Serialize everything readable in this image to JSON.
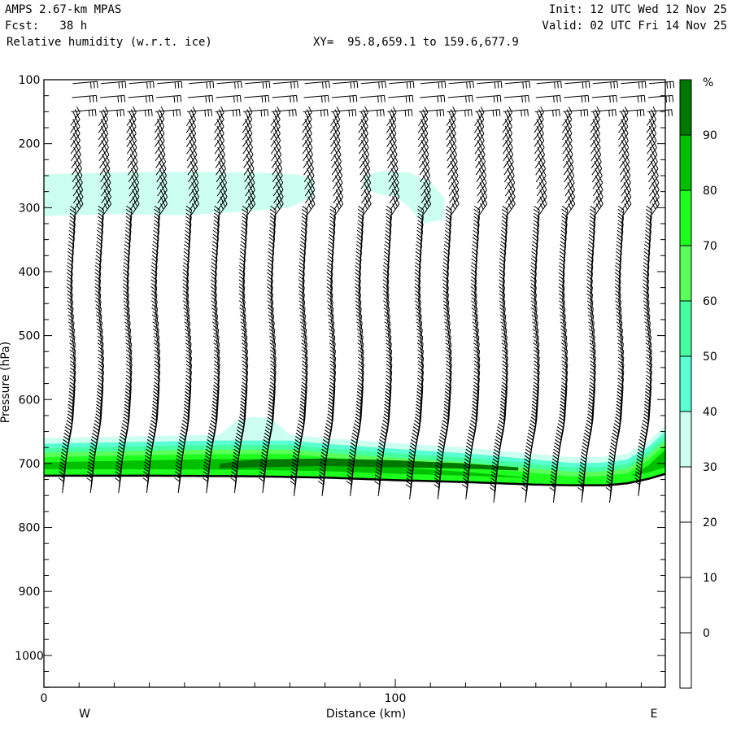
{
  "header": {
    "model": "AMPS 2.67-km MPAS",
    "fcst": "Fcst:   38 h",
    "field": "Relative humidity (w.r.t. ice)",
    "xy": "XY=  95.8,659.1 to 159.6,677.9",
    "init": "Init: 12 UTC Wed 12 Nov 25",
    "valid": "Valid: 02 UTC Fri 14 Nov 25"
  },
  "chart_data": {
    "type": "heatmap",
    "title": "Relative humidity (w.r.t. ice)",
    "xlabel": "Distance (km)",
    "ylabel": "Pressure (hPa)",
    "xlim": [
      0,
      177
    ],
    "ylim": [
      1050,
      100
    ],
    "xticks": [
      0,
      100
    ],
    "xtick_labels": [
      "0",
      "100"
    ],
    "x_minor_step": 10,
    "yticks": [
      100,
      200,
      300,
      400,
      500,
      600,
      700,
      800,
      900,
      1000
    ],
    "ytick_labels": [
      "100",
      "200",
      "300",
      "400",
      "500",
      "600",
      "700",
      "800",
      "900",
      "1000"
    ],
    "left_label": "W",
    "right_label": "E",
    "colorbar": {
      "unit": "%",
      "levels": [
        0,
        10,
        20,
        30,
        40,
        50,
        60,
        70,
        80,
        90
      ],
      "level_labels": [
        "0",
        "10",
        "20",
        "30",
        "40",
        "50",
        "60",
        "70",
        "80",
        "90"
      ],
      "colors": [
        "#ffffff",
        "#ffffff",
        "#ffffff",
        "#ffffff",
        "#cdfff0",
        "#5affd2",
        "#46ffa0",
        "#5aff5a",
        "#1eff1e",
        "#00c000",
        "#007800"
      ]
    },
    "ground_pressure": {
      "x": [
        0,
        30,
        60,
        80,
        100,
        120,
        140,
        150,
        160,
        166,
        172,
        177
      ],
      "p": [
        719,
        719,
        720,
        722,
        726,
        729,
        733,
        734,
        734,
        731,
        724,
        716
      ]
    },
    "low_cloud_top_30": {
      "x": [
        0,
        20,
        40,
        50,
        55,
        60,
        65,
        70,
        80,
        100,
        120,
        140,
        150,
        158,
        166,
        172,
        177
      ],
      "p": [
        660,
        658,
        656,
        655,
        632,
        627,
        630,
        655,
        660,
        668,
        675,
        685,
        690,
        690,
        685,
        665,
        640
      ]
    },
    "layer_offsets_hPa": {
      "40": 9,
      "50": 16,
      "60": 23,
      "70": 30,
      "80": 38
    },
    "band_90": {
      "x": [
        50,
        60,
        80,
        100,
        120,
        135
      ],
      "p_top": [
        700,
        694,
        692,
        695,
        700,
        706
      ],
      "p_bot": [
        708,
        706,
        704,
        706,
        708,
        711
      ]
    },
    "upper_cloud_30": [
      {
        "x": [
          0,
          20,
          40,
          60,
          72,
          77,
          77,
          70,
          60,
          40,
          20,
          0
        ],
        "p": [
          248,
          245,
          244,
          245,
          248,
          256,
          282,
          300,
          305,
          312,
          310,
          313
        ]
      },
      {
        "x": [
          91,
          96,
          104,
          110,
          114,
          114,
          108,
          104,
          100,
          96,
          91
        ],
        "p": [
          250,
          243,
          245,
          260,
          285,
          318,
          325,
          300,
          282,
          280,
          270
        ]
      }
    ],
    "wind_barb_columns_km": [
      8,
      16,
      24,
      32,
      41,
      49,
      57,
      65,
      74,
      82,
      90,
      98,
      107,
      115,
      123,
      131,
      140,
      148,
      156,
      164,
      172
    ]
  }
}
